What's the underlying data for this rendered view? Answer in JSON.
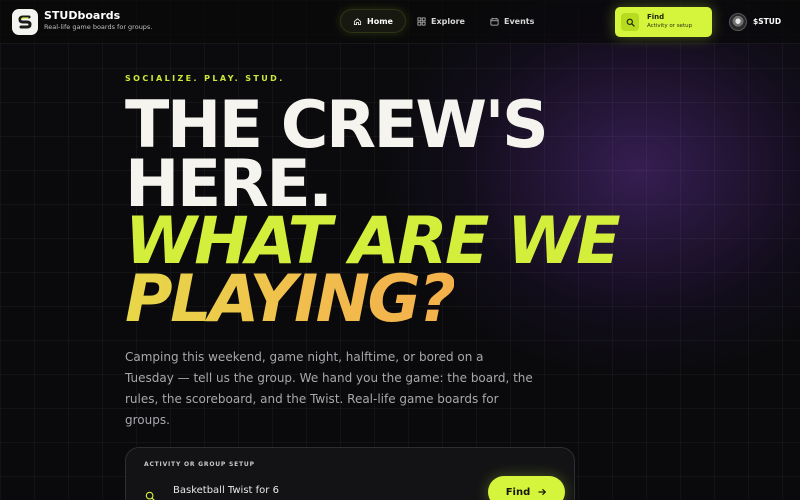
{
  "header": {
    "brand_name": "STUDboards",
    "brand_tagline": "Real-life game boards for groups.",
    "nav": [
      {
        "label": "Home",
        "icon": "home-icon",
        "active": true
      },
      {
        "label": "Explore",
        "icon": "grid-icon",
        "active": false
      },
      {
        "label": "Events",
        "icon": "calendar-icon",
        "active": false
      }
    ],
    "find": {
      "title": "Find",
      "subtitle": "Activity or setup",
      "icon": "search-icon"
    },
    "user": {
      "label": "$STUD",
      "avatar_icon": "coin-avatar-icon"
    }
  },
  "hero": {
    "kicker": "SOCIALIZE. PLAY. STUD.",
    "headline_line1": "THE CREW'S",
    "headline_line2": "HERE.",
    "headline_line3": "WHAT ARE WE",
    "headline_line4": "PLAYING?",
    "description": "Camping this weekend, game night, halftime, or bored on a Tuesday — tell us the group. We hand you the game: the board, the rules, the scoreboard, and the Twist. Real-life game boards for groups."
  },
  "search": {
    "label": "ACTIVITY OR GROUP SETUP",
    "value": "Basketball Twist for 6",
    "button_label": "Find",
    "button_icon": "arrow-right-icon"
  },
  "colors": {
    "accent": "#d4f53c",
    "headline_white": "#f5f4ee",
    "headline_gradient_end": "#f3b04a",
    "background": "#09090b"
  }
}
